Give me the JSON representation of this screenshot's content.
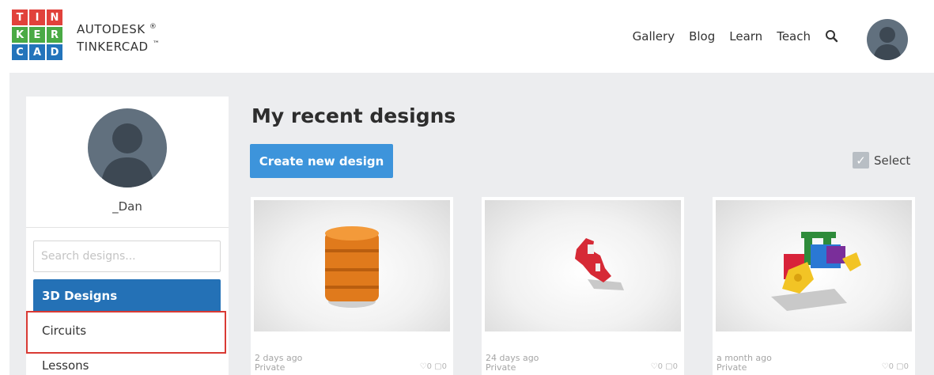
{
  "logo": {
    "tiles": [
      {
        "letter": "T",
        "color": "#e1423b"
      },
      {
        "letter": "I",
        "color": "#e1423b"
      },
      {
        "letter": "N",
        "color": "#e1423b"
      },
      {
        "letter": "K",
        "color": "#4aaa45"
      },
      {
        "letter": "E",
        "color": "#4aaa45"
      },
      {
        "letter": "R",
        "color": "#4aaa45"
      },
      {
        "letter": "C",
        "color": "#2374bb"
      },
      {
        "letter": "A",
        "color": "#2374bb"
      },
      {
        "letter": "D",
        "color": "#2374bb"
      }
    ],
    "brand_line1": "AUTODESK",
    "brand_line1_mark": "®",
    "brand_line2": "TINKERCAD",
    "brand_line2_mark": "™"
  },
  "nav": {
    "items": [
      "Gallery",
      "Blog",
      "Learn",
      "Teach"
    ],
    "search_icon": "search-icon"
  },
  "sidebar": {
    "username": "_Dan",
    "search_placeholder": "Search designs...",
    "items": [
      {
        "label": "3D Designs",
        "active": true
      },
      {
        "label": "Circuits",
        "active": false
      },
      {
        "label": "Lessons",
        "active": false
      }
    ]
  },
  "main": {
    "title": "My recent designs",
    "create_button": "Create new design",
    "select_label": "Select"
  },
  "designs": [
    {
      "time": "2 days ago",
      "visibility": "Private",
      "likes": "0",
      "comments": "0"
    },
    {
      "time": "24 days ago",
      "visibility": "Private",
      "likes": "0",
      "comments": "0"
    },
    {
      "time": "a month ago",
      "visibility": "Private",
      "likes": "0",
      "comments": "0"
    }
  ],
  "colors": {
    "accent_blue": "#3d94db",
    "active_item": "#2471b6",
    "highlight_red": "#d93a34"
  }
}
